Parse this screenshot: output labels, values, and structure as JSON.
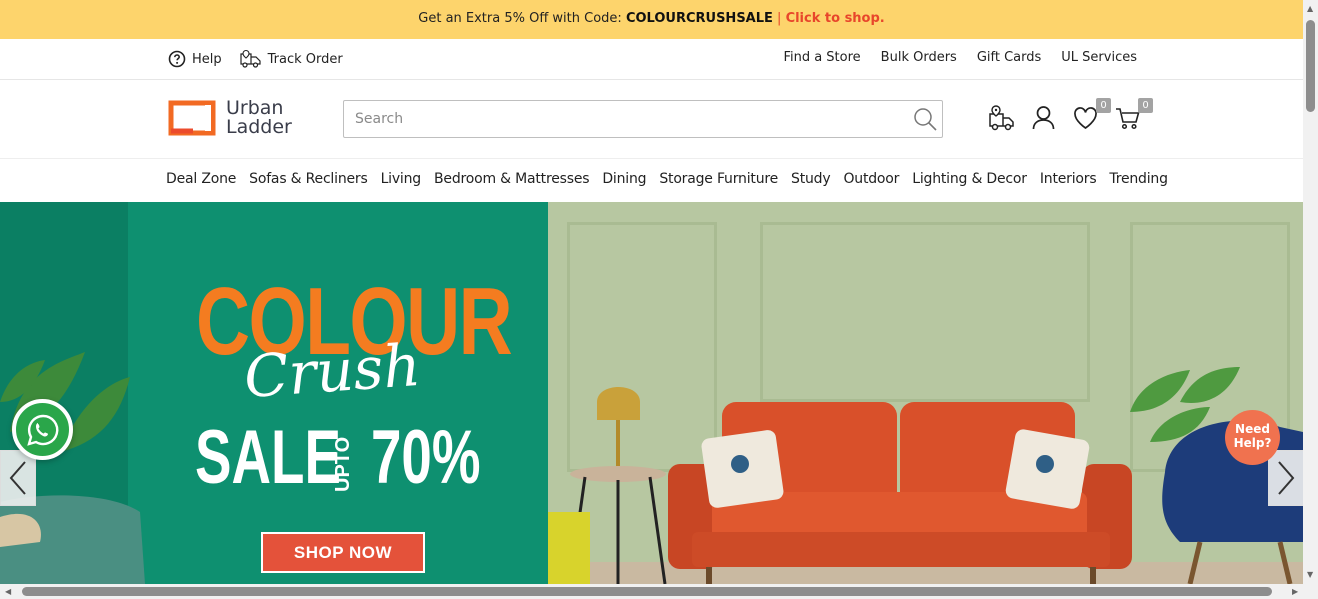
{
  "promo": {
    "text": "Get an Extra 5% Off with Code: ",
    "code": "COLOURCRUSHSALE",
    "separator": " | ",
    "cta": "Click to shop."
  },
  "utility": {
    "help_label": "Help",
    "track_label": "Track Order",
    "links": [
      "Find a Store",
      "Bulk Orders",
      "Gift Cards",
      "UL Services"
    ]
  },
  "header": {
    "logo_line1": "Urban",
    "logo_line2": "Ladder",
    "search_placeholder": "Search",
    "wishlist_count": "0",
    "cart_count": "0",
    "icons": [
      "delivery-icon",
      "user-icon",
      "heart-icon",
      "cart-icon"
    ]
  },
  "nav": {
    "items": [
      "Deal Zone",
      "Sofas & Recliners",
      "Living",
      "Bedroom & Mattresses",
      "Dining",
      "Storage Furniture",
      "Study",
      "Outdoor",
      "Lighting & Decor",
      "Interiors",
      "Trending"
    ]
  },
  "hero": {
    "line1": "COLOUR",
    "line2": "Crush",
    "line3": "SALE",
    "upto": "UPTO",
    "percent": "70%",
    "cta": "SHOP NOW"
  },
  "floating": {
    "need_help_line1": "Need",
    "need_help_line2": "Help?"
  },
  "colors": {
    "promo_bg": "#fdd46c",
    "accent": "#e8462b",
    "hero_green": "#0e9070",
    "hero_orange": "#f47c20",
    "sofa": "#d9502a",
    "whatsapp": "#2aa64a"
  }
}
